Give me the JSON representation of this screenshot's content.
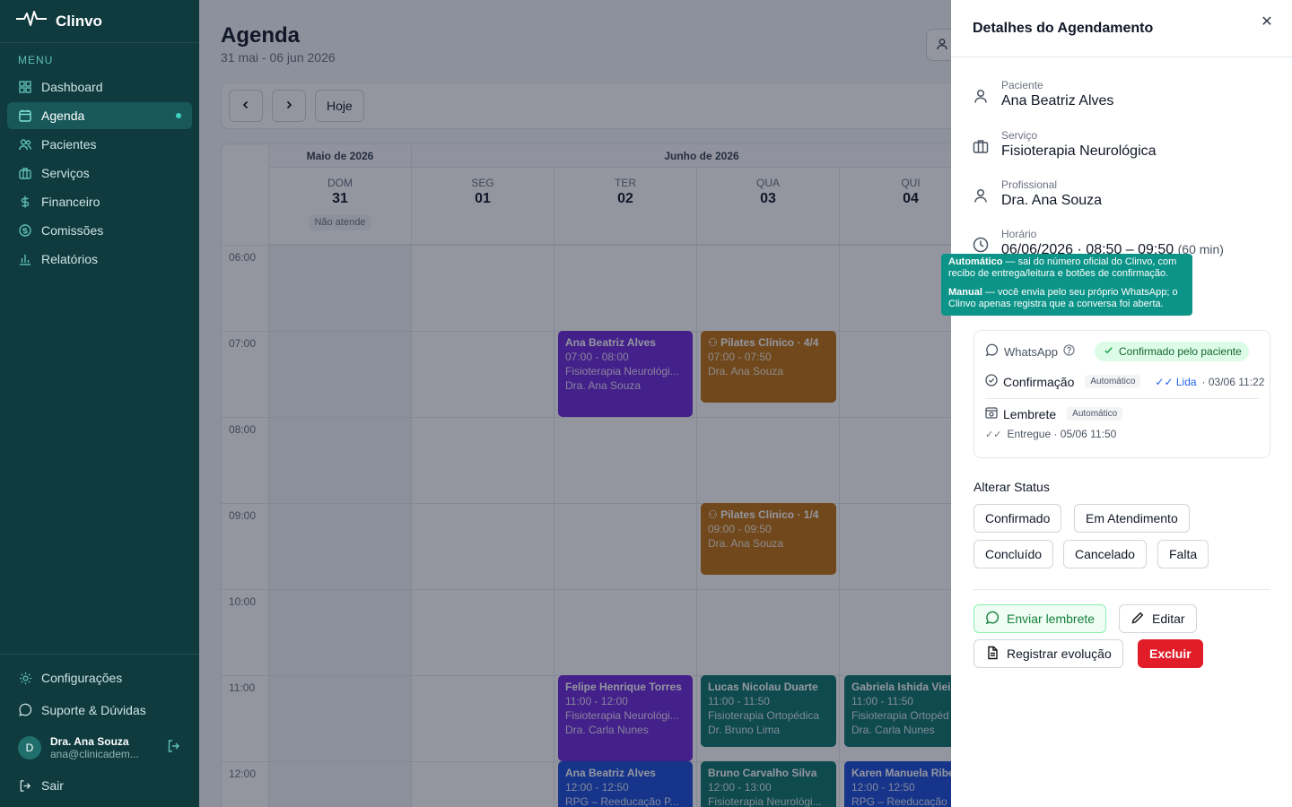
{
  "app": {
    "name": "Clinvo",
    "menu_label": "MENU"
  },
  "sidebar": {
    "items": [
      {
        "label": "Dashboard",
        "icon": "grid-icon"
      },
      {
        "label": "Agenda",
        "icon": "calendar-icon",
        "active": true
      },
      {
        "label": "Pacientes",
        "icon": "users-icon"
      },
      {
        "label": "Serviços",
        "icon": "briefcase-icon"
      },
      {
        "label": "Financeiro",
        "icon": "dollar-icon"
      },
      {
        "label": "Comissões",
        "icon": "coin-icon"
      },
      {
        "label": "Relatórios",
        "icon": "chart-icon"
      }
    ],
    "settings": "Configurações",
    "support": "Suporte & Dúvidas",
    "user": {
      "initial": "D",
      "name": "Dra. Ana Souza",
      "email": "ana@clinicadem..."
    },
    "logout": "Sair"
  },
  "page": {
    "title": "Agenda",
    "range": "31 mai - 06 jun 2026"
  },
  "toolbar": {
    "prev": "‹",
    "next": "›",
    "today": "Hoje"
  },
  "calendar": {
    "months": [
      {
        "label": "Maio de 2026"
      },
      {
        "label": "Junho de 2026"
      }
    ],
    "days": [
      {
        "name": "DOM",
        "num": "31",
        "note": "Não atende"
      },
      {
        "name": "SEG",
        "num": "01"
      },
      {
        "name": "TER",
        "num": "02"
      },
      {
        "name": "QUA",
        "num": "03"
      },
      {
        "name": "QUI",
        "num": "04"
      }
    ],
    "hours": [
      "06:00",
      "07:00",
      "08:00",
      "09:00",
      "10:00",
      "11:00",
      "12:00"
    ],
    "events": [
      {
        "title": "Ana Beatriz Alves",
        "time": "07:00 - 08:00",
        "service": "Fisioterapia Neurológi...",
        "pro": "Dra. Ana Souza"
      },
      {
        "title": "Pilates Clínico · 4/4",
        "time": "07:00 - 07:50",
        "service": "Dra. Ana Souza"
      },
      {
        "title": "Pilates Clínico · 1/4",
        "time": "09:00 - 09:50",
        "service": "Dra. Ana Souza"
      },
      {
        "title": "Felipe Henrique Torres",
        "time": "11:00 - 12:00",
        "service": "Fisioterapia Neurológi...",
        "pro": "Dra. Carla Nunes"
      },
      {
        "title": "Lucas Nicolau Duarte",
        "time": "11:00 - 11:50",
        "service": "Fisioterapia Ortopédica",
        "pro": "Dr. Bruno Lima"
      },
      {
        "title": "Gabriela Ishida Viei",
        "time": "11:00 - 11:50",
        "service": "Fisioterapia Ortopéd",
        "pro": "Dra. Carla Nunes"
      },
      {
        "title": "Ana Beatriz Alves",
        "time": "12:00 - 12:50",
        "service": "RPG – Reeducação P..."
      },
      {
        "title": "Bruno Carvalho Silva",
        "time": "12:00 - 13:00",
        "service": "Fisioterapia Neurológi..."
      },
      {
        "title": "Karen Manuela Ribe",
        "time": "12:00 - 12:50",
        "service": "RPG – Reeducação"
      }
    ]
  },
  "drawer": {
    "title": "Detalhes do Agendamento",
    "close": "✕",
    "patient": {
      "label": "Paciente",
      "value": "Ana Beatriz Alves"
    },
    "service": {
      "label": "Serviço",
      "value": "Fisioterapia Neurológica"
    },
    "professional": {
      "label": "Profissional",
      "value": "Dra. Ana Souza"
    },
    "time": {
      "label": "Horário",
      "value": "06/06/2026 · 08:50 – 09:50",
      "duration": "(60 min)"
    },
    "tooltip": {
      "auto_title": "Automático",
      "auto_text": " — sai do número oficial do Clinvo, com recibo de entrega/leitura e botões de confirmação.",
      "manual_title": "Manual",
      "manual_text": " — você envia pelo seu próprio WhatsApp; o Clinvo apenas registra que a conversa foi aberta."
    },
    "whatsapp": {
      "label": "WhatsApp",
      "status": "Confirmado pelo paciente",
      "confirm_label": "Confirmação",
      "confirm_tag": "Automático",
      "confirm_read": "Lida",
      "confirm_time": "· 03/06 11:22",
      "reminder_label": "Lembrete",
      "reminder_tag": "Automático",
      "reminder_status": "Entregue · 05/06 11:50"
    },
    "status_section": "Alterar Status",
    "statuses": [
      "Confirmado",
      "Em Atendimento",
      "Concluído",
      "Cancelado",
      "Falta"
    ],
    "actions": {
      "reminder": "Enviar lembrete",
      "edit": "Editar",
      "evolution": "Registrar evolução",
      "delete": "Excluir"
    }
  }
}
